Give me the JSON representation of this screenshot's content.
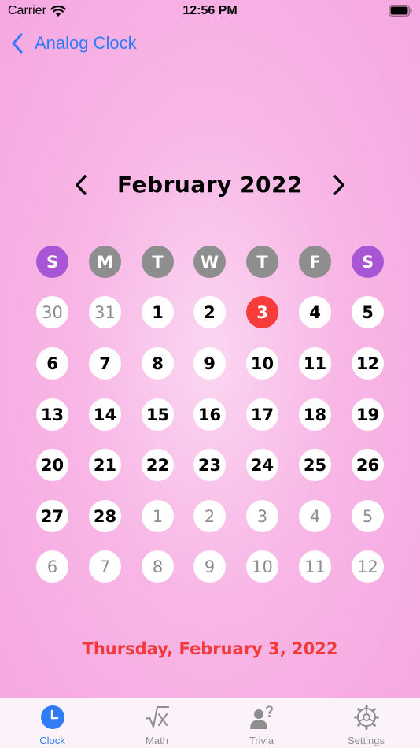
{
  "status_bar": {
    "carrier": "Carrier",
    "time": "12:56 PM"
  },
  "nav": {
    "back_label": "Analog Clock"
  },
  "calendar": {
    "month_title": "February 2022",
    "weekdays": [
      "S",
      "M",
      "T",
      "W",
      "T",
      "F",
      "S"
    ],
    "weekday_colors": [
      "#a856d6",
      "#8e8e8e",
      "#8e8e8e",
      "#8e8e8e",
      "#8e8e8e",
      "#8e8e8e",
      "#a856d6"
    ],
    "weeks": [
      [
        {
          "d": "30",
          "other": true
        },
        {
          "d": "31",
          "other": true
        },
        {
          "d": "1"
        },
        {
          "d": "2"
        },
        {
          "d": "3",
          "today": true
        },
        {
          "d": "4"
        },
        {
          "d": "5"
        }
      ],
      [
        {
          "d": "6"
        },
        {
          "d": "7"
        },
        {
          "d": "8"
        },
        {
          "d": "9"
        },
        {
          "d": "10"
        },
        {
          "d": "11"
        },
        {
          "d": "12"
        }
      ],
      [
        {
          "d": "13"
        },
        {
          "d": "14"
        },
        {
          "d": "15"
        },
        {
          "d": "16"
        },
        {
          "d": "17"
        },
        {
          "d": "18"
        },
        {
          "d": "19"
        }
      ],
      [
        {
          "d": "20"
        },
        {
          "d": "21"
        },
        {
          "d": "22"
        },
        {
          "d": "23"
        },
        {
          "d": "24"
        },
        {
          "d": "25"
        },
        {
          "d": "26"
        }
      ],
      [
        {
          "d": "27"
        },
        {
          "d": "28"
        },
        {
          "d": "1",
          "other": true
        },
        {
          "d": "2",
          "other": true
        },
        {
          "d": "3",
          "other": true
        },
        {
          "d": "4",
          "other": true
        },
        {
          "d": "5",
          "other": true
        }
      ],
      [
        {
          "d": "6",
          "other": true
        },
        {
          "d": "7",
          "other": true
        },
        {
          "d": "8",
          "other": true
        },
        {
          "d": "9",
          "other": true
        },
        {
          "d": "10",
          "other": true
        },
        {
          "d": "11",
          "other": true
        },
        {
          "d": "12",
          "other": true
        }
      ]
    ],
    "selected_date_label": "Thursday, February 3, 2022"
  },
  "colors": {
    "accent": "#2f7cf6",
    "today": "#f63d3b",
    "weekend": "#a856d6",
    "weekday": "#8e8e8e"
  },
  "tabs": [
    {
      "label": "Clock",
      "icon": "clock-icon",
      "active": true
    },
    {
      "label": "Math",
      "icon": "square-root-icon",
      "active": false
    },
    {
      "label": "Trivia",
      "icon": "person-question-icon",
      "active": false
    },
    {
      "label": "Settings",
      "icon": "gear-icon",
      "active": false
    }
  ]
}
